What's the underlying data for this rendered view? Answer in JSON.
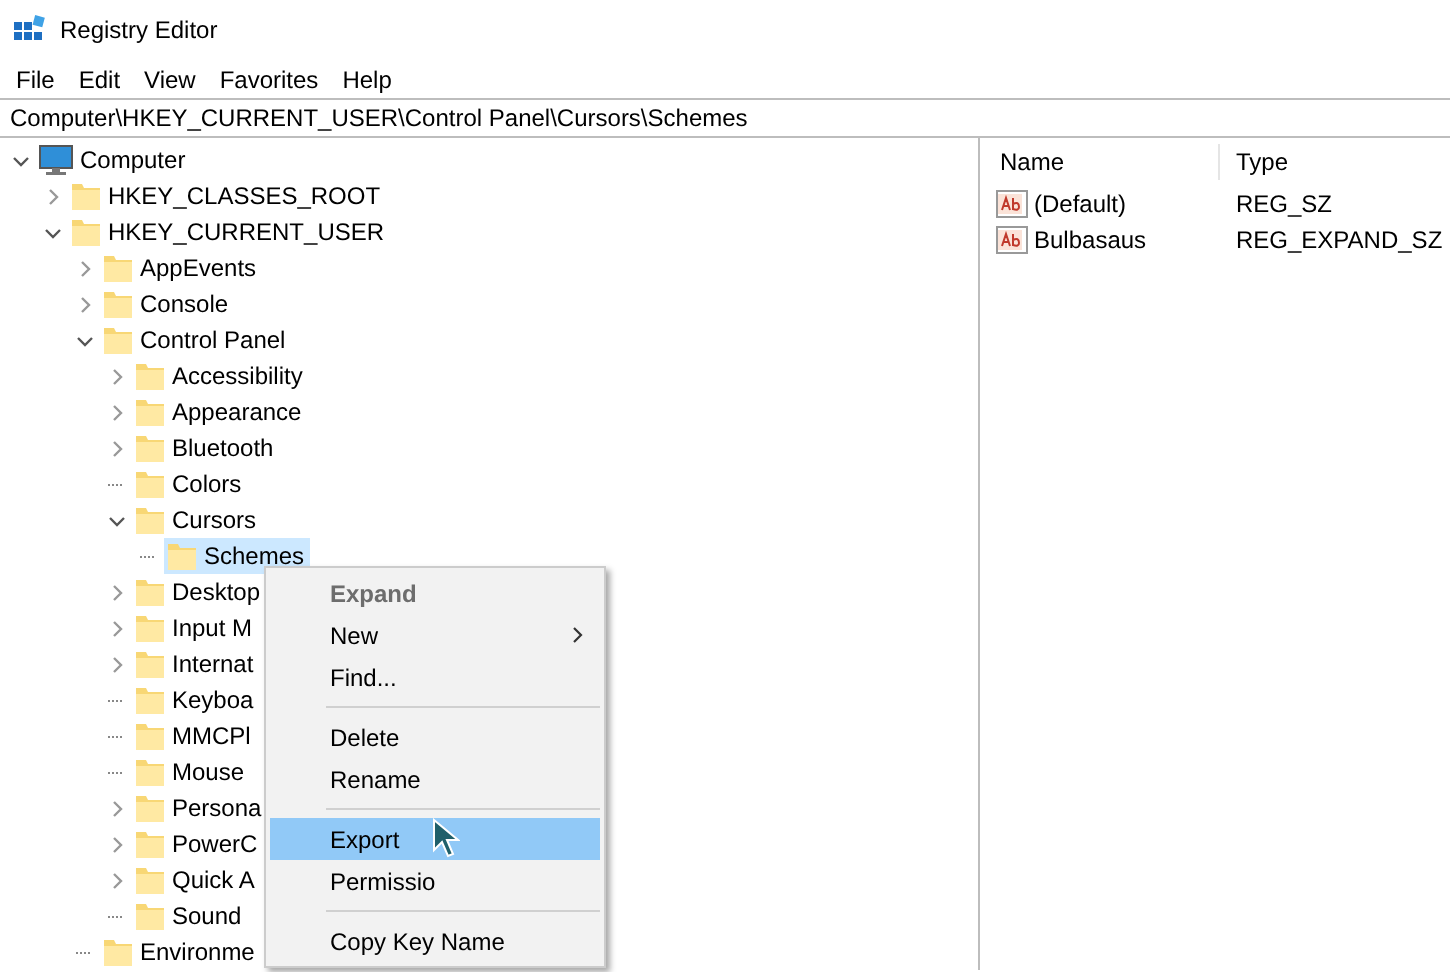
{
  "window": {
    "title": "Registry Editor"
  },
  "menu_bar": [
    "File",
    "Edit",
    "View",
    "Favorites",
    "Help"
  ],
  "address_bar": {
    "value": "Computer\\HKEY_CURRENT_USER\\Control Panel\\Cursors\\Schemes"
  },
  "tree": [
    {
      "label": "Computer",
      "kind": "computer",
      "expanded": true,
      "selected": false,
      "children": [
        {
          "label": "HKEY_CLASSES_ROOT",
          "kind": "branch",
          "expanded": false,
          "selected": false
        },
        {
          "label": "HKEY_CURRENT_USER",
          "kind": "branch",
          "expanded": true,
          "selected": false,
          "children": [
            {
              "label": "AppEvents",
              "kind": "branch",
              "expanded": false,
              "selected": false
            },
            {
              "label": "Console",
              "kind": "branch",
              "expanded": false,
              "selected": false
            },
            {
              "label": "Control Panel",
              "kind": "branch",
              "expanded": true,
              "selected": false,
              "children": [
                {
                  "label": "Accessibility",
                  "kind": "branch",
                  "expanded": false,
                  "selected": false
                },
                {
                  "label": "Appearance",
                  "kind": "branch",
                  "expanded": false,
                  "selected": false
                },
                {
                  "label": "Bluetooth",
                  "kind": "branch",
                  "expanded": false,
                  "selected": false
                },
                {
                  "label": "Colors",
                  "kind": "leaf",
                  "selected": false
                },
                {
                  "label": "Cursors",
                  "kind": "branch",
                  "expanded": true,
                  "selected": false,
                  "children": [
                    {
                      "label": "Schemes",
                      "kind": "leaf",
                      "selected": true
                    }
                  ]
                },
                {
                  "label": "Desktop",
                  "kind": "branch",
                  "expanded": false,
                  "selected": false
                },
                {
                  "label": "Input M",
                  "kind": "branch",
                  "expanded": false,
                  "selected": false
                },
                {
                  "label": "Internat",
                  "kind": "branch",
                  "expanded": false,
                  "selected": false
                },
                {
                  "label": "Keyboa",
                  "kind": "leaf",
                  "selected": false
                },
                {
                  "label": "MMCPl",
                  "kind": "leaf",
                  "selected": false
                },
                {
                  "label": "Mouse",
                  "kind": "leaf",
                  "selected": false
                },
                {
                  "label": "Persona",
                  "kind": "branch",
                  "expanded": false,
                  "selected": false
                },
                {
                  "label": "PowerC",
                  "kind": "branch",
                  "expanded": false,
                  "selected": false
                },
                {
                  "label": "Quick A",
                  "kind": "branch",
                  "expanded": false,
                  "selected": false
                },
                {
                  "label": "Sound",
                  "kind": "leaf",
                  "selected": false
                }
              ]
            },
            {
              "label": "Environme",
              "kind": "leaf",
              "selected": false
            }
          ]
        }
      ]
    }
  ],
  "values": {
    "columns": [
      "Name",
      "Type"
    ],
    "rows": [
      {
        "name": "(Default)",
        "type": "REG_SZ"
      },
      {
        "name": "Bulbasaus",
        "type": "REG_EXPAND_SZ"
      }
    ]
  },
  "context_menu": [
    {
      "kind": "item",
      "label": "Expand",
      "disabled": true,
      "default": true,
      "selected": false,
      "submenu": false
    },
    {
      "kind": "item",
      "label": "New",
      "disabled": false,
      "default": false,
      "selected": false,
      "submenu": true
    },
    {
      "kind": "item",
      "label": "Find...",
      "disabled": false,
      "default": false,
      "selected": false,
      "submenu": false
    },
    {
      "kind": "separator"
    },
    {
      "kind": "item",
      "label": "Delete",
      "disabled": false,
      "default": false,
      "selected": false,
      "submenu": false
    },
    {
      "kind": "item",
      "label": "Rename",
      "disabled": false,
      "default": false,
      "selected": false,
      "submenu": false
    },
    {
      "kind": "separator"
    },
    {
      "kind": "item",
      "label": "Export",
      "disabled": false,
      "default": false,
      "selected": true,
      "submenu": false
    },
    {
      "kind": "item",
      "label": "Permissio",
      "disabled": false,
      "default": false,
      "selected": false,
      "submenu": false
    },
    {
      "kind": "separator"
    },
    {
      "kind": "item",
      "label": "Copy Key Name",
      "disabled": false,
      "default": false,
      "selected": false,
      "submenu": false
    }
  ]
}
